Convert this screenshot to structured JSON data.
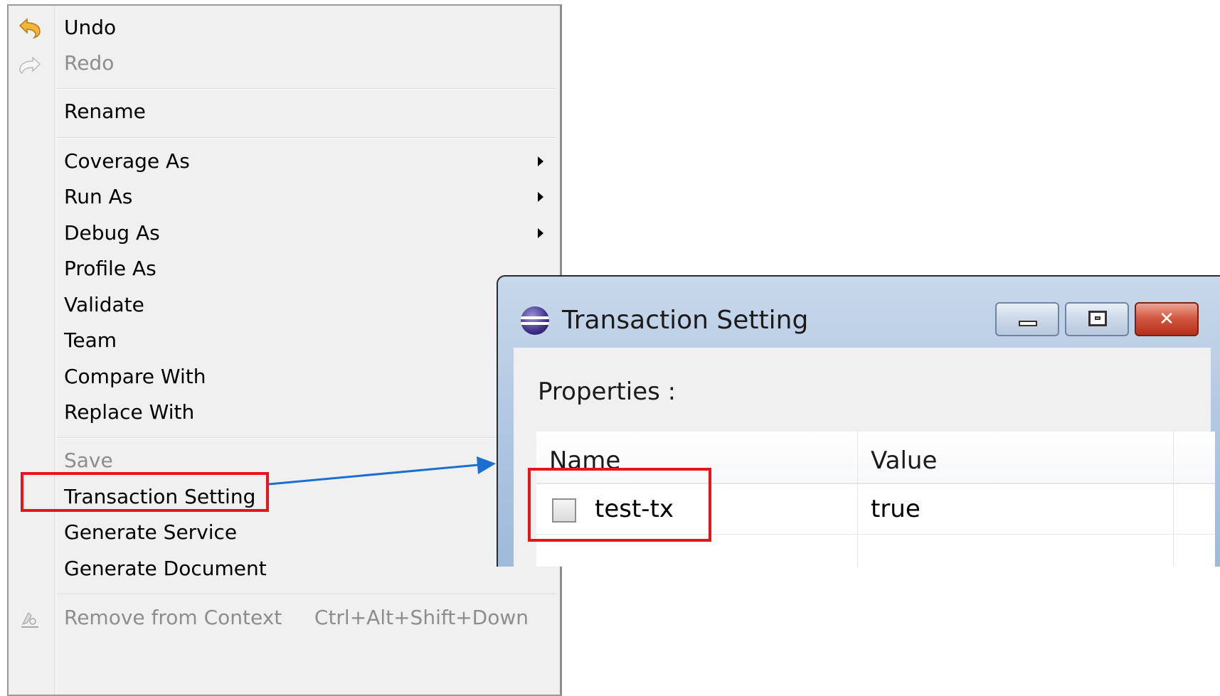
{
  "context_menu": {
    "items": [
      {
        "label": "Undo",
        "icon": "undo-arrow-icon"
      },
      {
        "label": "Redo",
        "icon": "redo-arrow-icon",
        "disabled": true
      },
      {
        "label": "Rename"
      },
      {
        "label": "Coverage As",
        "submenu": true
      },
      {
        "label": "Run As",
        "submenu": true
      },
      {
        "label": "Debug As",
        "submenu": true
      },
      {
        "label": "Profile As"
      },
      {
        "label": "Validate"
      },
      {
        "label": "Team"
      },
      {
        "label": "Compare With"
      },
      {
        "label": "Replace With"
      },
      {
        "label": "Save",
        "disabled": true
      },
      {
        "label": "Transaction Setting",
        "highlighted": true
      },
      {
        "label": "Generate Service"
      },
      {
        "label": "Generate Document"
      },
      {
        "label": "Remove from Context",
        "disabled": true,
        "shortcut": "Ctrl+Alt+Shift+Down",
        "icon": "remove-context-icon"
      }
    ]
  },
  "dialog": {
    "title": "Transaction Setting",
    "icon": "eclipse-globe-icon",
    "window_buttons": [
      "minimize",
      "maximize",
      "close"
    ],
    "properties_label": "Properties :",
    "table": {
      "columns": [
        "Name",
        "Value"
      ],
      "rows": [
        {
          "name": "test-tx",
          "value": "true",
          "checked": false
        }
      ]
    }
  },
  "annotation": {
    "highlight_color": "#e8141c",
    "arrow_color": "#1a6fd1"
  }
}
